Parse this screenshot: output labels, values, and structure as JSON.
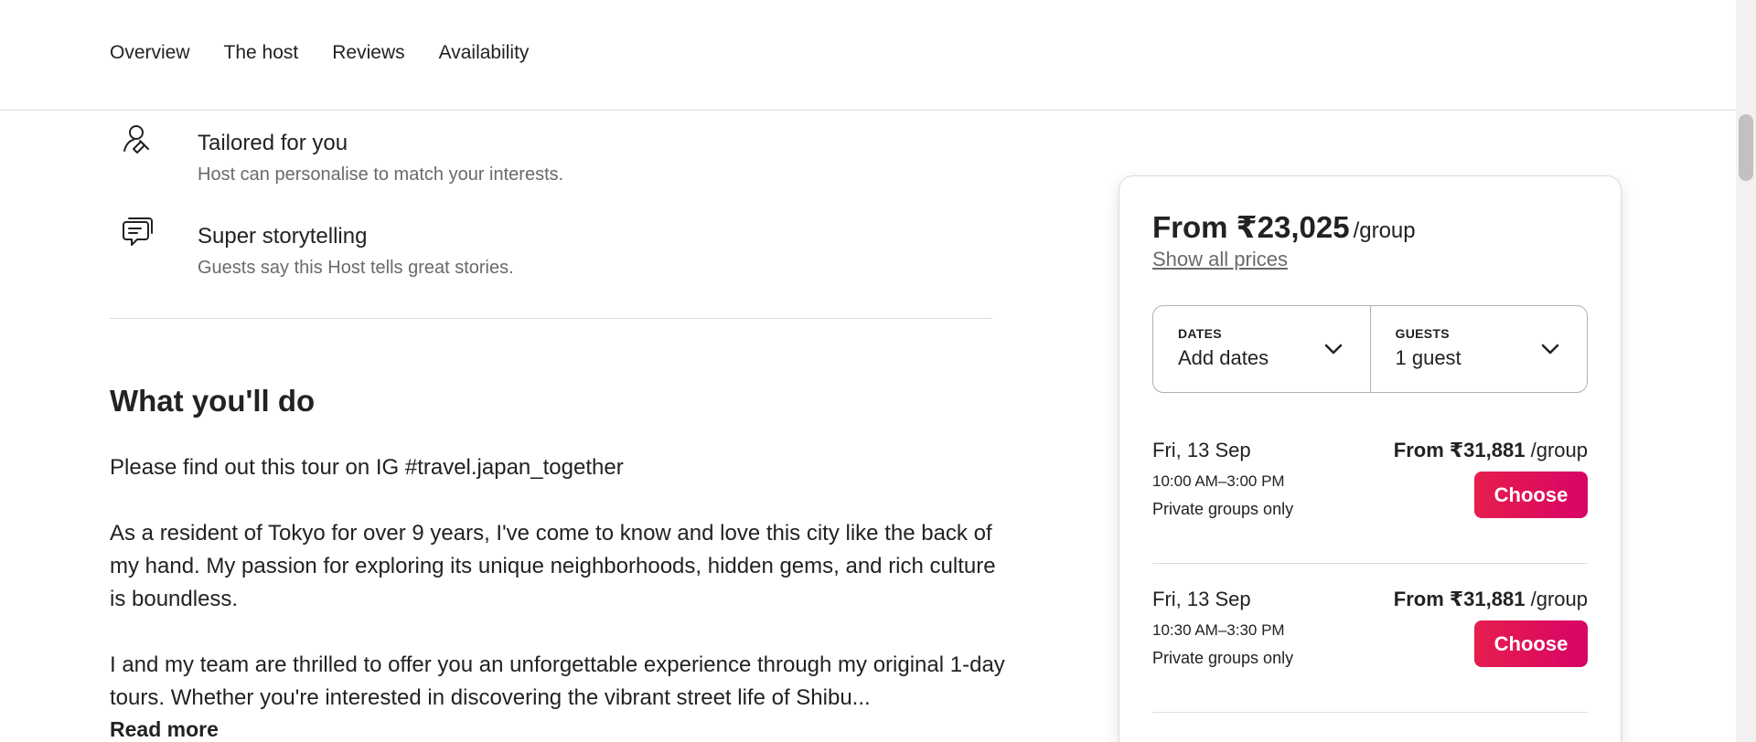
{
  "nav": {
    "tabs": [
      "Overview",
      "The host",
      "Reviews",
      "Availability"
    ]
  },
  "features": [
    {
      "icon": "user-pen-icon",
      "title": "Tailored for you",
      "description": "Host can personalise to match your interests."
    },
    {
      "icon": "chat-bubble-icon",
      "title": "Super storytelling",
      "description": "Guests say this Host tells great stories."
    }
  ],
  "what_youll_do": {
    "title": "What you'll do",
    "paragraphs": [
      "Please find out this tour on IG #travel.japan_together",
      "As a resident of Tokyo for over 9 years, I've come to know and love this city like the back of my hand. My passion for exploring its unique neighborhoods, hidden gems, and rich culture is boundless.",
      "I and my team are thrilled to offer you an unforgettable experience through my original 1-day tours. Whether you're interested in discovering the vibrant street life of Shibu..."
    ],
    "read_more": "Read more"
  },
  "booking": {
    "price_prefix": "From ₹23,025",
    "price_unit": "/group",
    "show_all_prices": "Show all prices",
    "dates": {
      "label": "DATES",
      "value": "Add dates"
    },
    "guests": {
      "label": "GUESTS",
      "value": "1 guest"
    },
    "slots": [
      {
        "date": "Fri, 13 Sep",
        "time": "10:00 AM–3:00 PM",
        "note": "Private groups only",
        "price": "From ₹31,881",
        "unit": "/group",
        "button": "Choose"
      },
      {
        "date": "Fri, 13 Sep",
        "time": "10:30 AM–3:30 PM",
        "note": "Private groups only",
        "price": "From ₹31,881",
        "unit": "/group",
        "button": "Choose"
      }
    ],
    "accent_color": "#e61e4d"
  }
}
